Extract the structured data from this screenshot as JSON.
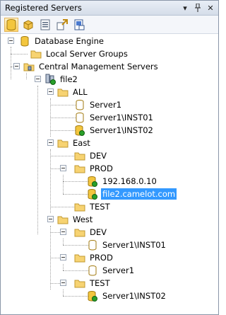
{
  "window": {
    "title": "Registered Servers",
    "controls": {
      "pin": "▾",
      "autohide": "⊥",
      "close": "✕"
    }
  },
  "toolbar": {
    "icons": [
      "database-engine-icon",
      "analysis-services-icon",
      "reporting-services-icon",
      "integration-services-icon",
      "sql-compact-icon"
    ]
  },
  "tree": {
    "root": "Database Engine",
    "local_groups": "Local Server Groups",
    "central": "Central Management Servers",
    "cms_server": "file2",
    "all": "ALL",
    "all_s1": "Server1",
    "all_s2": "Server1\\INST01",
    "all_s3": "Server1\\INST02",
    "east": "East",
    "east_dev": "DEV",
    "east_prod": "PROD",
    "east_prod_s1": "192.168.0.10",
    "east_prod_s2": "file2.camelot.com",
    "east_test": "TEST",
    "west": "West",
    "west_dev": "DEV",
    "west_dev_s1": "Server1\\INST01",
    "west_prod": "PROD",
    "west_prod_s1": "Server1",
    "west_test": "TEST",
    "west_test_s1": "Server1\\INST02"
  }
}
